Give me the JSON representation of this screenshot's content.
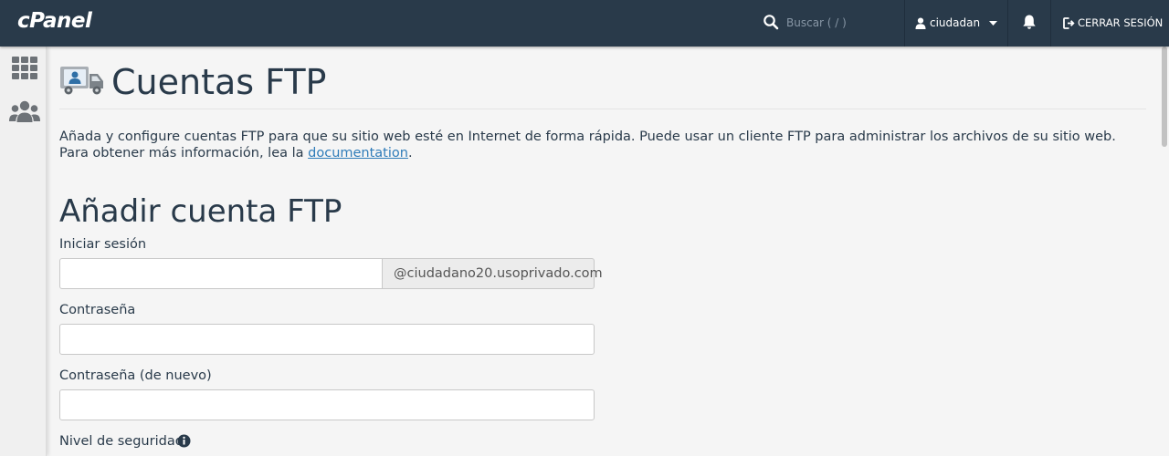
{
  "header": {
    "logo": "cPanel",
    "search_placeholder": "Buscar ( / )",
    "username": "ciudadan",
    "logout_label": "CERRAR SESIÓN"
  },
  "sidebar": {
    "items": [
      {
        "icon": "grid-icon"
      },
      {
        "icon": "users-icon"
      }
    ]
  },
  "page": {
    "title": "Cuentas FTP",
    "description_text": "Añada y configure cuentas FTP para que su sitio web esté en Internet de forma rápida. Puede usar un cliente FTP para administrar los archivos de su sitio web. Para obtener más información, lea la ",
    "doc_link": "documentation",
    "description_end": "."
  },
  "form": {
    "section_title": "Añadir cuenta FTP",
    "login_label": "Iniciar sesión",
    "login_value": "",
    "domain_suffix": "@ciudadano20.usoprivado.com",
    "password_label": "Contraseña",
    "password_value": "",
    "password_again_label": "Contraseña (de nuevo)",
    "password_again_value": "",
    "security_level_label": "Nivel de seguridad"
  },
  "colors": {
    "topbar": "#293a4a",
    "link": "#2f7cb9",
    "background": "#f5f5f5"
  }
}
